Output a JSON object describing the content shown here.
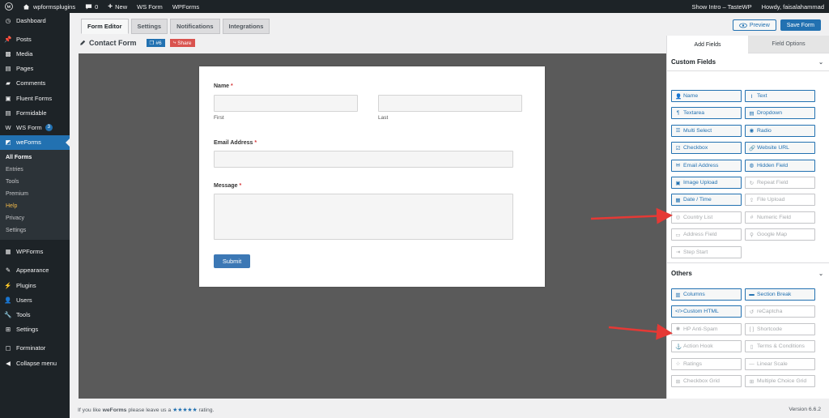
{
  "adminbar": {
    "site_name": "wpformsplugins",
    "comments_count": "0",
    "new_label": "New",
    "links": [
      "WS Form",
      "WPForms"
    ],
    "show_intro": "Show Intro – TasteWP",
    "howdy": "Howdy, faisalahammad"
  },
  "sidebar": {
    "items_top": [
      {
        "label": "Dashboard",
        "icon": "dashboard-icon"
      },
      {
        "label": "Posts",
        "icon": "pin-icon"
      },
      {
        "label": "Media",
        "icon": "media-icon"
      },
      {
        "label": "Pages",
        "icon": "pages-icon"
      },
      {
        "label": "Comments",
        "icon": "comments-icon"
      },
      {
        "label": "Fluent Forms",
        "icon": "fluent-forms-icon"
      },
      {
        "label": "Formidable",
        "icon": "formidable-icon"
      },
      {
        "label": "WS Form",
        "icon": "ws-form-icon",
        "badge": "3"
      },
      {
        "label": "weForms",
        "icon": "weforms-icon"
      }
    ],
    "submenu": [
      "All Forms",
      "Entries",
      "Tools",
      "Premium",
      "Help",
      "Privacy",
      "Settings"
    ],
    "items_bottom": [
      {
        "label": "WPForms",
        "icon": "wpforms-icon"
      },
      {
        "label": "Appearance",
        "icon": "appearance-icon"
      },
      {
        "label": "Plugins",
        "icon": "plugins-icon"
      },
      {
        "label": "Users",
        "icon": "users-icon"
      },
      {
        "label": "Tools",
        "icon": "tools-icon"
      },
      {
        "label": "Settings",
        "icon": "settings-icon"
      },
      {
        "label": "Forminator",
        "icon": "forminator-icon"
      },
      {
        "label": "Collapse menu",
        "icon": "collapse-icon"
      }
    ]
  },
  "editor": {
    "tabs": [
      "Form Editor",
      "Settings",
      "Notifications",
      "Integrations"
    ],
    "form_title": "Contact Form",
    "form_id": "#6",
    "share_label": "Share",
    "preview_label": "Preview",
    "save_label": "Save Form"
  },
  "form": {
    "name_label": "Name",
    "required_mark": "*",
    "first_sub": "First",
    "last_sub": "Last",
    "email_label": "Email Address",
    "message_label": "Message",
    "submit_label": "Submit"
  },
  "panel": {
    "tab_add": "Add Fields",
    "tab_options": "Field Options",
    "custom_title": "Custom Fields",
    "others_title": "Others",
    "custom_fields": [
      {
        "label": "Name",
        "icon": "user-icon",
        "enabled": true
      },
      {
        "label": "Text",
        "icon": "text-icon",
        "enabled": true
      },
      {
        "label": "Textarea",
        "icon": "paragraph-icon",
        "enabled": true
      },
      {
        "label": "Dropdown",
        "icon": "dropdown-icon",
        "enabled": true
      },
      {
        "label": "Multi Select",
        "icon": "list-icon",
        "enabled": true
      },
      {
        "label": "Radio",
        "icon": "radio-icon",
        "enabled": true
      },
      {
        "label": "Checkbox",
        "icon": "checkbox-icon",
        "enabled": true
      },
      {
        "label": "Website URL",
        "icon": "link-icon",
        "enabled": true
      },
      {
        "label": "Email Address",
        "icon": "envelope-icon",
        "enabled": true
      },
      {
        "label": "Hidden Field",
        "icon": "eye-slash-icon",
        "enabled": true
      },
      {
        "label": "Image Upload",
        "icon": "image-icon",
        "enabled": true
      },
      {
        "label": "Repeat Field",
        "icon": "repeat-icon",
        "enabled": false
      },
      {
        "label": "Date / Time",
        "icon": "calendar-icon",
        "enabled": true
      },
      {
        "label": "File Upload",
        "icon": "upload-icon",
        "enabled": false
      },
      {
        "label": "Country List",
        "icon": "globe-icon",
        "enabled": false
      },
      {
        "label": "Numeric Field",
        "icon": "hash-icon",
        "enabled": false
      },
      {
        "label": "Address Field",
        "icon": "address-card-icon",
        "enabled": false
      },
      {
        "label": "Google Map",
        "icon": "map-marker-icon",
        "enabled": false
      },
      {
        "label": "Step Start",
        "icon": "step-icon",
        "enabled": false
      }
    ],
    "other_fields": [
      {
        "label": "Columns",
        "icon": "columns-icon",
        "enabled": true
      },
      {
        "label": "Section Break",
        "icon": "section-icon",
        "enabled": true
      },
      {
        "label": "Custom HTML",
        "icon": "code-icon",
        "enabled": true
      },
      {
        "label": "reCaptcha",
        "icon": "recaptcha-icon",
        "enabled": false
      },
      {
        "label": "HP Anti-Spam",
        "icon": "shield-icon",
        "enabled": false
      },
      {
        "label": "Shortcode",
        "icon": "shortcode-icon",
        "enabled": false
      },
      {
        "label": "Action Hook",
        "icon": "anchor-icon",
        "enabled": false
      },
      {
        "label": "Terms & Conditions",
        "icon": "file-icon",
        "enabled": false
      },
      {
        "label": "Ratings",
        "icon": "star-icon",
        "enabled": false
      },
      {
        "label": "Linear Scale",
        "icon": "scale-icon",
        "enabled": false
      },
      {
        "label": "Checkbox Grid",
        "icon": "grid-icon",
        "enabled": false
      },
      {
        "label": "Multiple Choice Grid",
        "icon": "grid-icon",
        "enabled": false
      }
    ]
  },
  "footer": {
    "text_before": "If you like",
    "brand": "weForms",
    "text_mid": "please leave us a",
    "stars": "★★★★★",
    "text_after": "rating.",
    "version": "Version 6.6.2"
  },
  "colors": {
    "wp_dark": "#1d2327",
    "wp_blue": "#2271b1",
    "share_red": "#d9534f",
    "canvas_gray": "#5a5a5a",
    "arrow_red": "#e53935"
  }
}
